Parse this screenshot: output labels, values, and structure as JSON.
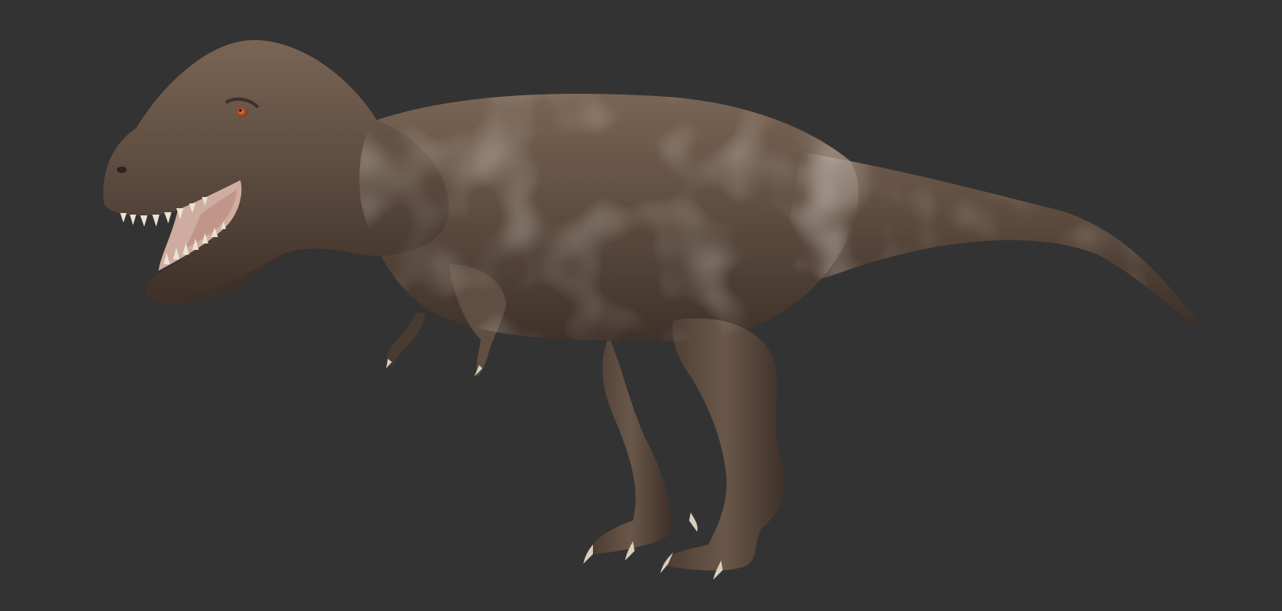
{
  "scene": {
    "subject": "tyrannosaurus-rex-render",
    "colors": {
      "background": "#333333",
      "skin_base": "#5f4e41",
      "skin_dark": "#3e3129",
      "skin_light": "#8a7564",
      "skin_pale": "#9a8a7c",
      "teeth": "#eae3d2",
      "mouth": "#d8b3a7",
      "eye": "#b5562f",
      "claw": "#d9cfbd"
    }
  }
}
